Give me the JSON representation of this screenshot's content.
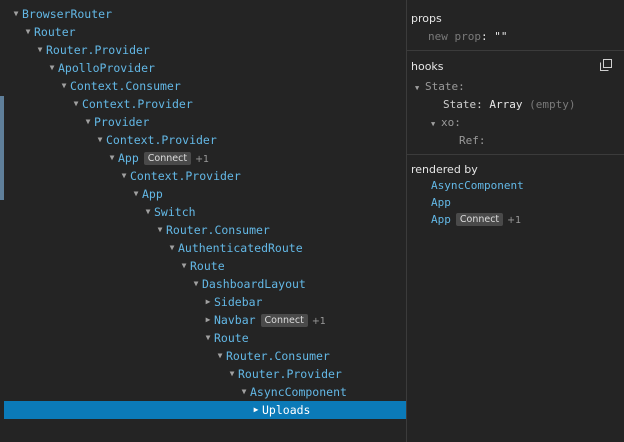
{
  "tree": {
    "rows": [
      {
        "label": "BrowserRouter",
        "depth": 0,
        "expanded": true
      },
      {
        "label": "Router",
        "depth": 1,
        "expanded": true
      },
      {
        "label": "Router.Provider",
        "depth": 2,
        "expanded": true
      },
      {
        "label": "ApolloProvider",
        "depth": 3,
        "expanded": true
      },
      {
        "label": "Context.Consumer",
        "depth": 4,
        "expanded": true
      },
      {
        "label": "Context.Provider",
        "depth": 5,
        "expanded": true
      },
      {
        "label": "Provider",
        "depth": 6,
        "expanded": true
      },
      {
        "label": "Context.Provider",
        "depth": 7,
        "expanded": true
      },
      {
        "label": "App",
        "depth": 8,
        "expanded": true,
        "badge": "Connect",
        "extra": "+1"
      },
      {
        "label": "Context.Provider",
        "depth": 9,
        "expanded": true
      },
      {
        "label": "App",
        "depth": 10,
        "expanded": true
      },
      {
        "label": "Switch",
        "depth": 11,
        "expanded": true
      },
      {
        "label": "Router.Consumer",
        "depth": 12,
        "expanded": true
      },
      {
        "label": "AuthenticatedRoute",
        "depth": 13,
        "expanded": true
      },
      {
        "label": "Route",
        "depth": 14,
        "expanded": true
      },
      {
        "label": "DashboardLayout",
        "depth": 15,
        "expanded": true
      },
      {
        "label": "Sidebar",
        "depth": 16,
        "expanded": false
      },
      {
        "label": "Navbar",
        "depth": 16,
        "expanded": false,
        "badge": "Connect",
        "extra": "+1"
      },
      {
        "label": "Route",
        "depth": 16,
        "expanded": true
      },
      {
        "label": "Router.Consumer",
        "depth": 17,
        "expanded": true
      },
      {
        "label": "Router.Provider",
        "depth": 18,
        "expanded": true
      },
      {
        "label": "AsyncComponent",
        "depth": 19,
        "expanded": true
      },
      {
        "label": "Uploads",
        "depth": 20,
        "expanded": false,
        "selected": true
      }
    ]
  },
  "props": {
    "title": "props",
    "new_prop_key": "new prop",
    "colon": ":",
    "new_prop_value": "\"\""
  },
  "hooks": {
    "title": "hooks",
    "state_label": "State:",
    "state_key": "State:",
    "state_value": "Array",
    "state_note": "(empty)",
    "xo_label": "xo:",
    "ref_label": "Ref:"
  },
  "rendered_by": {
    "title": "rendered by",
    "items": [
      {
        "label": "AsyncComponent"
      },
      {
        "label": "App"
      },
      {
        "label": "App",
        "badge": "Connect",
        "extra": "+1"
      }
    ]
  },
  "icons": {
    "expanded": "caret-down-icon",
    "collapsed": "caret-right-icon",
    "copy": "copy-icon"
  },
  "colors": {
    "background": "#242424",
    "component_name": "#63b8e6",
    "selection": "#0b7ab8",
    "badge": "#4a4a4a"
  }
}
